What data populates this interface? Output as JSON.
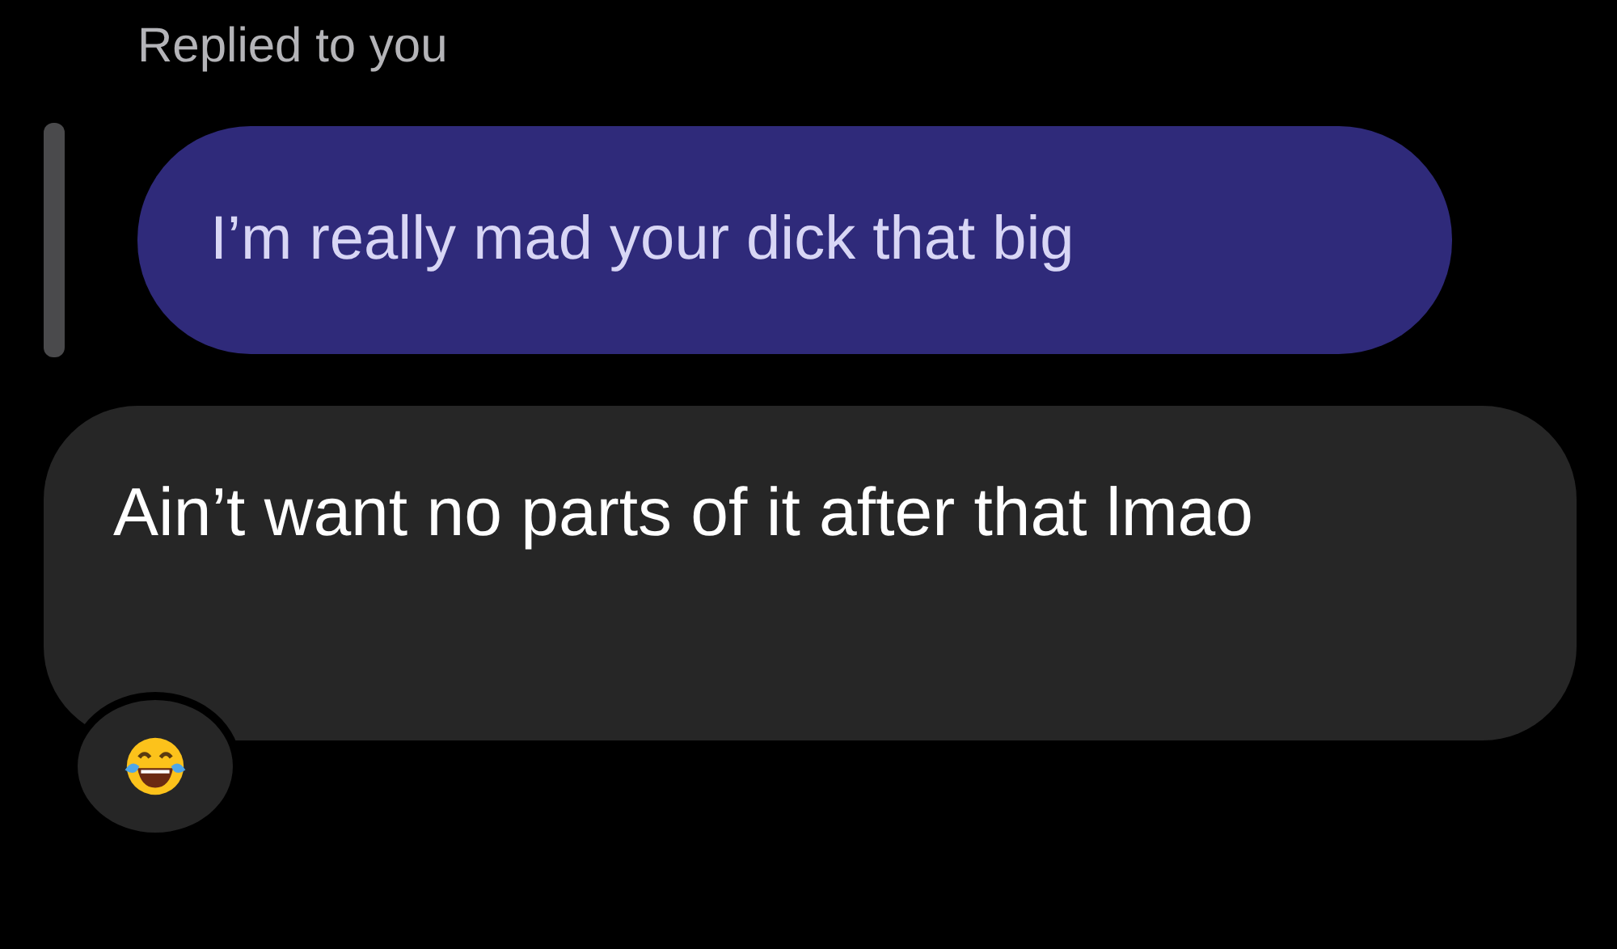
{
  "reply_label": "Replied to you",
  "quoted_message": {
    "text": "I’m really mad your dick that big"
  },
  "message": {
    "text": "Ain’t want no parts of it after that lmao"
  },
  "reaction": {
    "kind": "laughing"
  }
}
